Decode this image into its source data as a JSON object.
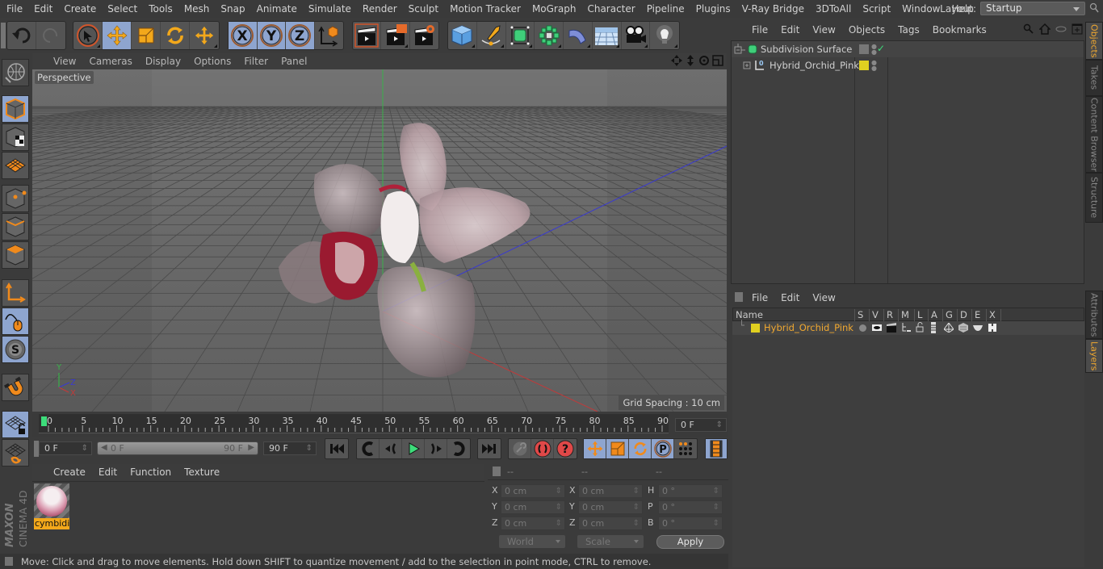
{
  "menubar": {
    "items": [
      "File",
      "Edit",
      "Create",
      "Select",
      "Tools",
      "Mesh",
      "Snap",
      "Animate",
      "Simulate",
      "Render",
      "Sculpt",
      "Motion Tracker",
      "MoGraph",
      "Character",
      "Pipeline",
      "Plugins",
      "V-Ray Bridge",
      "3DToAll",
      "Script",
      "Window",
      "Help"
    ],
    "layout_label": "Layout:",
    "layout_value": "Startup"
  },
  "toolbar": {
    "icons": [
      "undo-icon",
      "redo-icon",
      "live-selection-icon",
      "move-icon",
      "scale-icon",
      "rotate-icon",
      "last-tool-move-icon",
      "x-axis-lock-icon",
      "y-axis-lock-icon",
      "z-axis-lock-icon",
      "world-coordinate-system-icon",
      "render-view-icon",
      "render-to-picture-viewer-icon",
      "render-settings-icon",
      "cube-icon",
      "pen-spline-icon",
      "subdivision-surface-icon",
      "cloner-icon",
      "deformer-bend-icon",
      "floor-icon",
      "camera-icon",
      "light-icon"
    ]
  },
  "left_toolbar": {
    "icons": [
      "make-editable-icon",
      "model-mode-icon",
      "texture-mode-icon",
      "workplane-mode-icon",
      "points-mode-icon",
      "edges-mode-icon",
      "polygons-mode-icon",
      "axis-mode-icon",
      "tweak-mode-icon",
      "solo-icon",
      "snap-icon",
      "workplane-lock-icon",
      "workplane-align-icon"
    ]
  },
  "viewport": {
    "menu": [
      "View",
      "Cameras",
      "Display",
      "Options",
      "Filter",
      "Panel"
    ],
    "camera_label": "Perspective",
    "grid_spacing": "Grid Spacing : 10 cm",
    "axis_labels": {
      "x": "X",
      "y": "Y",
      "z": "Z"
    },
    "object": "Hybrid_Orchid_Pink"
  },
  "timeline": {
    "ticks": [
      "0",
      "5",
      "10",
      "15",
      "20",
      "25",
      "30",
      "35",
      "40",
      "45",
      "50",
      "55",
      "60",
      "65",
      "70",
      "75",
      "80",
      "85",
      "90"
    ],
    "current_frame": "0 F",
    "start_field": "0 F",
    "range_start": "0 F",
    "range_end": "90 F",
    "end_field": "90 F",
    "range_fraction_start": 0,
    "range_fraction_end": 1
  },
  "transport": {
    "buttons": [
      "go-to-start",
      "go-to-previous-keyframe",
      "go-to-previous-frame",
      "play-forwards",
      "go-to-next-frame",
      "go-to-next-keyframe",
      "go-to-end",
      "record-active-objects",
      "autokeying",
      "keyframe-selection",
      "record-position",
      "record-scale",
      "record-rotation",
      "record-parameter",
      "record-point-level",
      "timeline-window"
    ]
  },
  "materials": {
    "menu": [
      "Create",
      "Edit",
      "Function",
      "Texture"
    ],
    "items": [
      {
        "name": "cymbidium"
      }
    ],
    "visible_name": "cymbidi"
  },
  "coordinates": {
    "headers": [
      "--",
      "--",
      "--"
    ],
    "rows": [
      {
        "l1": "X",
        "v1": "0 cm",
        "l2": "X",
        "v2": "0 cm",
        "l3": "H",
        "v3": "0 °"
      },
      {
        "l1": "Y",
        "v1": "0 cm",
        "l2": "Y",
        "v2": "0 cm",
        "l3": "P",
        "v3": "0 °"
      },
      {
        "l1": "Z",
        "v1": "0 cm",
        "l2": "Z",
        "v2": "0 cm",
        "l3": "B",
        "v3": "0 °"
      }
    ],
    "coord_system": "World",
    "mode": "Scale",
    "apply_label": "Apply"
  },
  "status_bar": {
    "text": "Move: Click and drag to move elements. Hold down SHIFT to quantize movement / add to the selection in point mode, CTRL to remove."
  },
  "objects_panel": {
    "menu": [
      "File",
      "Edit",
      "View",
      "Objects",
      "Tags",
      "Bookmarks"
    ],
    "items": [
      {
        "name": "Subdivision Surface",
        "icon": "subdivision-surface-icon",
        "enabled": true
      },
      {
        "name": "Hybrid_Orchid_Pink",
        "icon": "null-object-icon",
        "layer_color": "#e0d020"
      }
    ]
  },
  "layers_panel": {
    "menu": [
      "File",
      "Edit",
      "View"
    ],
    "columns": [
      "Name",
      "S",
      "V",
      "R",
      "M",
      "L",
      "A",
      "G",
      "D",
      "E",
      "X"
    ],
    "rows": [
      {
        "name": "Hybrid_Orchid_Pink",
        "color": "#e0d020"
      }
    ]
  },
  "right_tabs": {
    "top": [
      "Objects",
      "Takes",
      "Content Browser",
      "Structure"
    ],
    "bottom": [
      "Attributes",
      "Layers"
    ],
    "active_top": "Objects",
    "active_bottom": "Layers"
  },
  "logo": {
    "brand": "MAXON",
    "product": "CINEMA 4D"
  },
  "colors": {
    "accent_orange": "#f3a81b",
    "active_blue": "#8ea5cf",
    "layer_yellow": "#e0d020",
    "selected_text": "#f0a830"
  }
}
